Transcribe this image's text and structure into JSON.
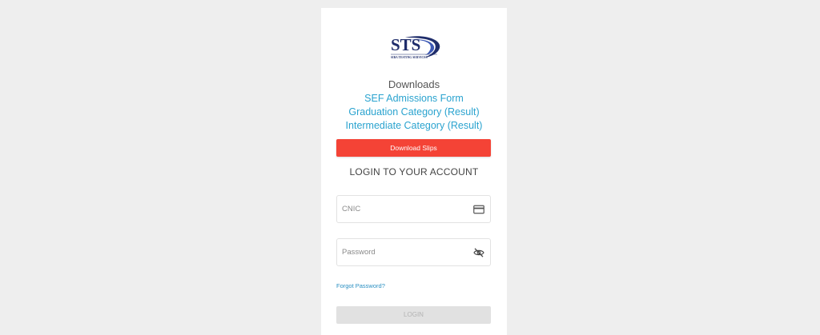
{
  "logo": {
    "title": "STS",
    "subtitle": "SIBA TESTING SERVICES",
    "color": "#1f2d6b"
  },
  "downloads": {
    "title": "Downloads",
    "links": [
      {
        "label": "SEF Admissions Form"
      },
      {
        "label": "Graduation Category (Result)"
      },
      {
        "label": "Intermediate Category (Result)"
      }
    ],
    "link_color": "#2aa3cf"
  },
  "download_slips": {
    "label": "Download Slips",
    "color": "#f44336"
  },
  "login": {
    "heading": "LOGIN TO YOUR ACCOUNT",
    "cnic": {
      "placeholder": "CNIC",
      "value": "",
      "icon": "credit-card-icon"
    },
    "password": {
      "placeholder": "Password",
      "value": "",
      "icon": "eye-off-icon"
    },
    "forgot_label": "Forgot Password?",
    "button_label": "LOGIN"
  }
}
